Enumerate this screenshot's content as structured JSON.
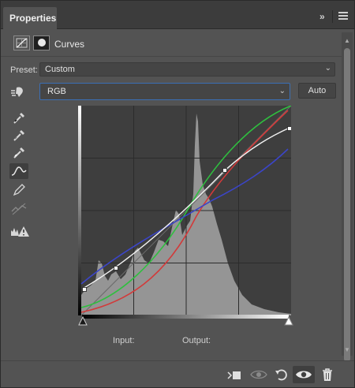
{
  "window": {
    "tab_title": "Properties",
    "expand_glyph": "»",
    "close_glyph": "×"
  },
  "header": {
    "title": "Curves",
    "icons": [
      "curves-adjustment-icon",
      "layer-mask-icon"
    ]
  },
  "preset": {
    "label": "Preset:",
    "value": "Custom"
  },
  "channel": {
    "value": "RGB",
    "auto_label": "Auto"
  },
  "tools": [
    "on-image-adjust-icon",
    "black-point-eyedropper-icon",
    "gray-point-eyedropper-icon",
    "white-point-eyedropper-icon",
    "curve-edit-icon",
    "pencil-icon",
    "smooth-icon",
    "clipping-warning-icon"
  ],
  "io": {
    "input_label": "Input:",
    "output_label": "Output:"
  },
  "footer_icons": [
    "clip-to-layer-icon",
    "view-previous-icon",
    "reset-icon",
    "visibility-icon",
    "delete-icon"
  ],
  "colors": {
    "accent": "#3b6fb5",
    "curve_rgb": "#f2f2f2",
    "curve_red": "#d23a3a",
    "curve_green": "#2fbf3f",
    "curve_blue": "#3b45c8",
    "histogram": "#9a9a9a",
    "graph_bg": "#3e3e3e"
  }
}
